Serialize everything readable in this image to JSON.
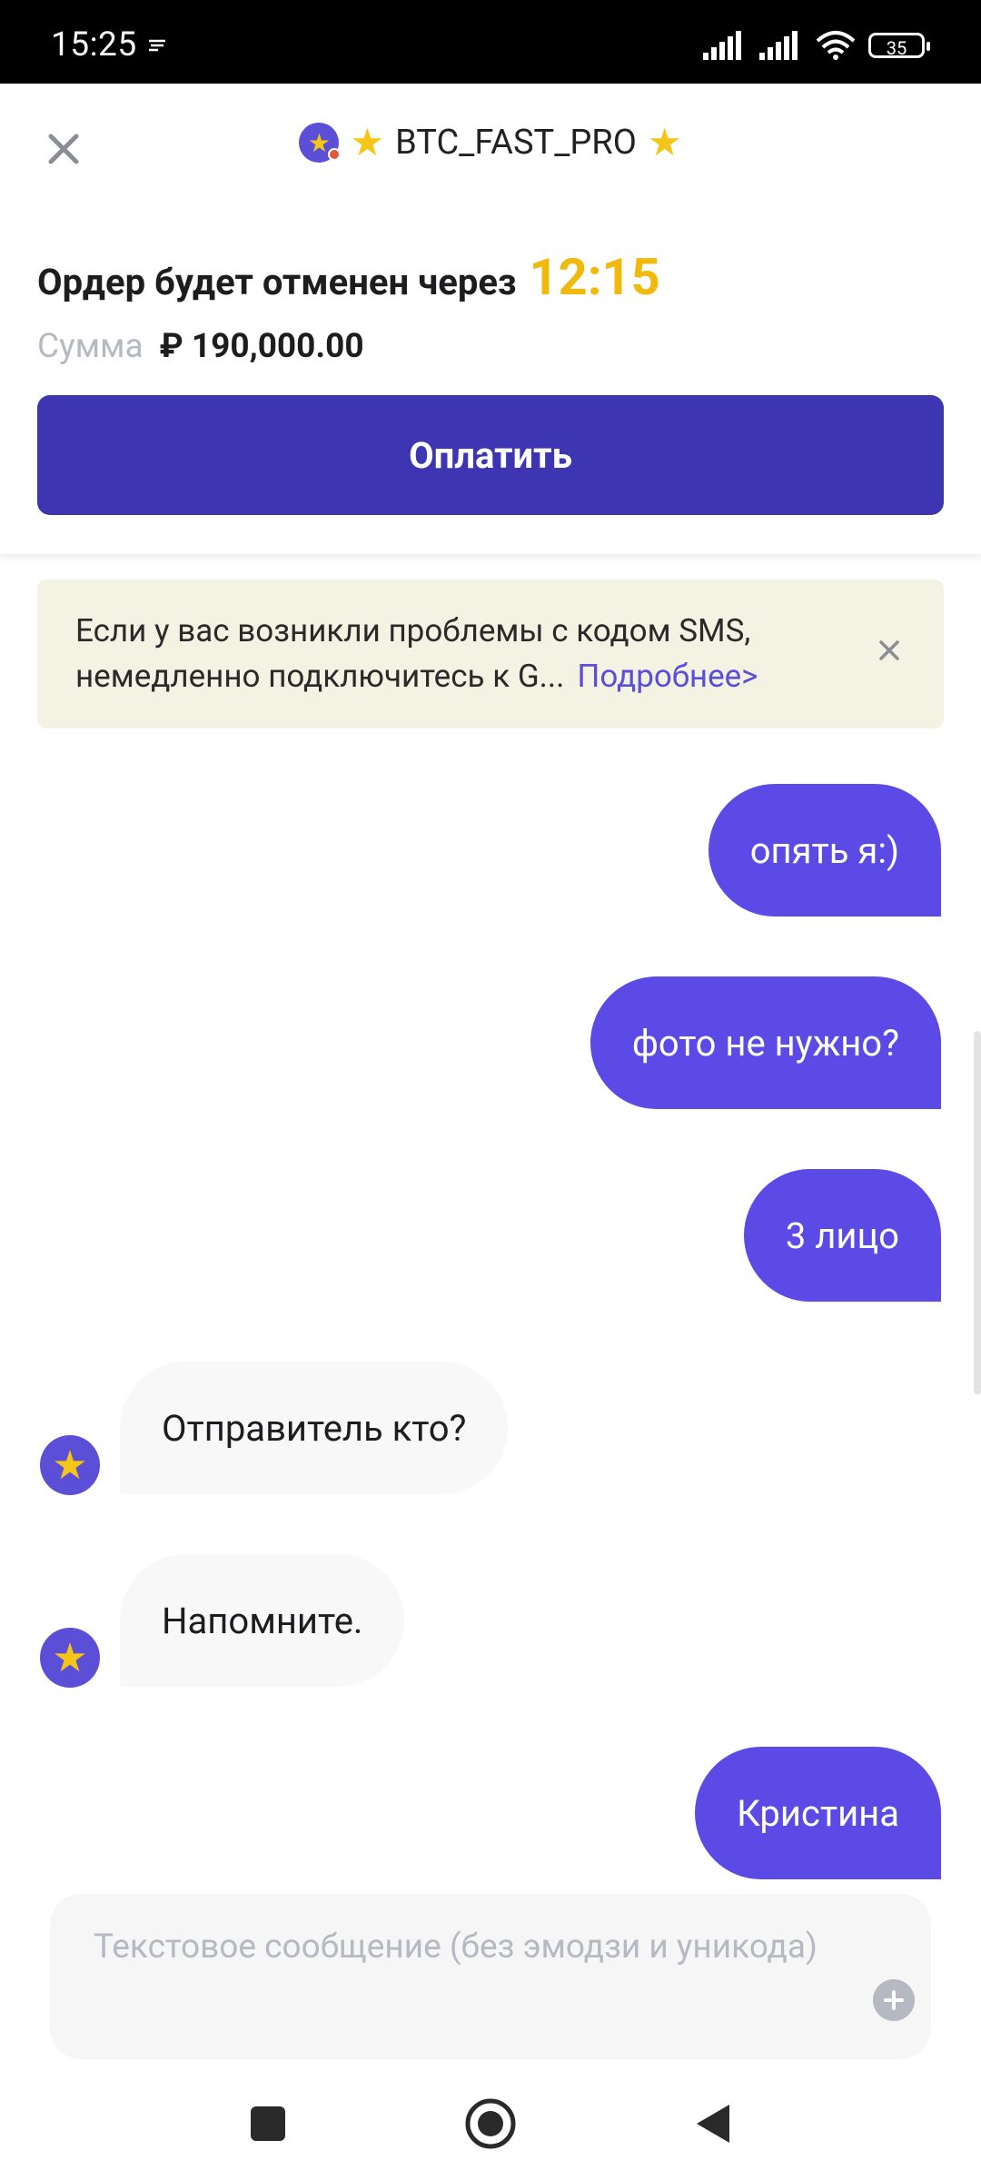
{
  "status_bar": {
    "time": "15:25",
    "battery": "35"
  },
  "header": {
    "merchant_name": "BTC_FAST_PRO",
    "order_cancel_text": "Ордер будет отменен через",
    "timer": "12:15",
    "sum_label": "Сумма",
    "sum_value": "₽ 190,000.00",
    "pay_button": "Оплатить"
  },
  "notice": {
    "text": "Если у вас возникли проблемы с кодом SMS, немедленно подключитесь к G...",
    "link": "Подробнее>"
  },
  "messages": [
    {
      "direction": "out",
      "text": "опять я:)"
    },
    {
      "direction": "out",
      "text": "фото не нужно?"
    },
    {
      "direction": "out",
      "text": "3 лицо"
    },
    {
      "direction": "in",
      "text": "Отправитель кто?"
    },
    {
      "direction": "in",
      "text": "Напомните."
    },
    {
      "direction": "out",
      "text": "Кристина"
    }
  ],
  "composer": {
    "placeholder": "Текстовое сообщение (без эмодзи и уникода)"
  },
  "colors": {
    "accent": "#3d35b1",
    "bubble_out": "#5b4ae6",
    "timer": "#f0b90b",
    "notice_bg": "#f4f2e2"
  }
}
